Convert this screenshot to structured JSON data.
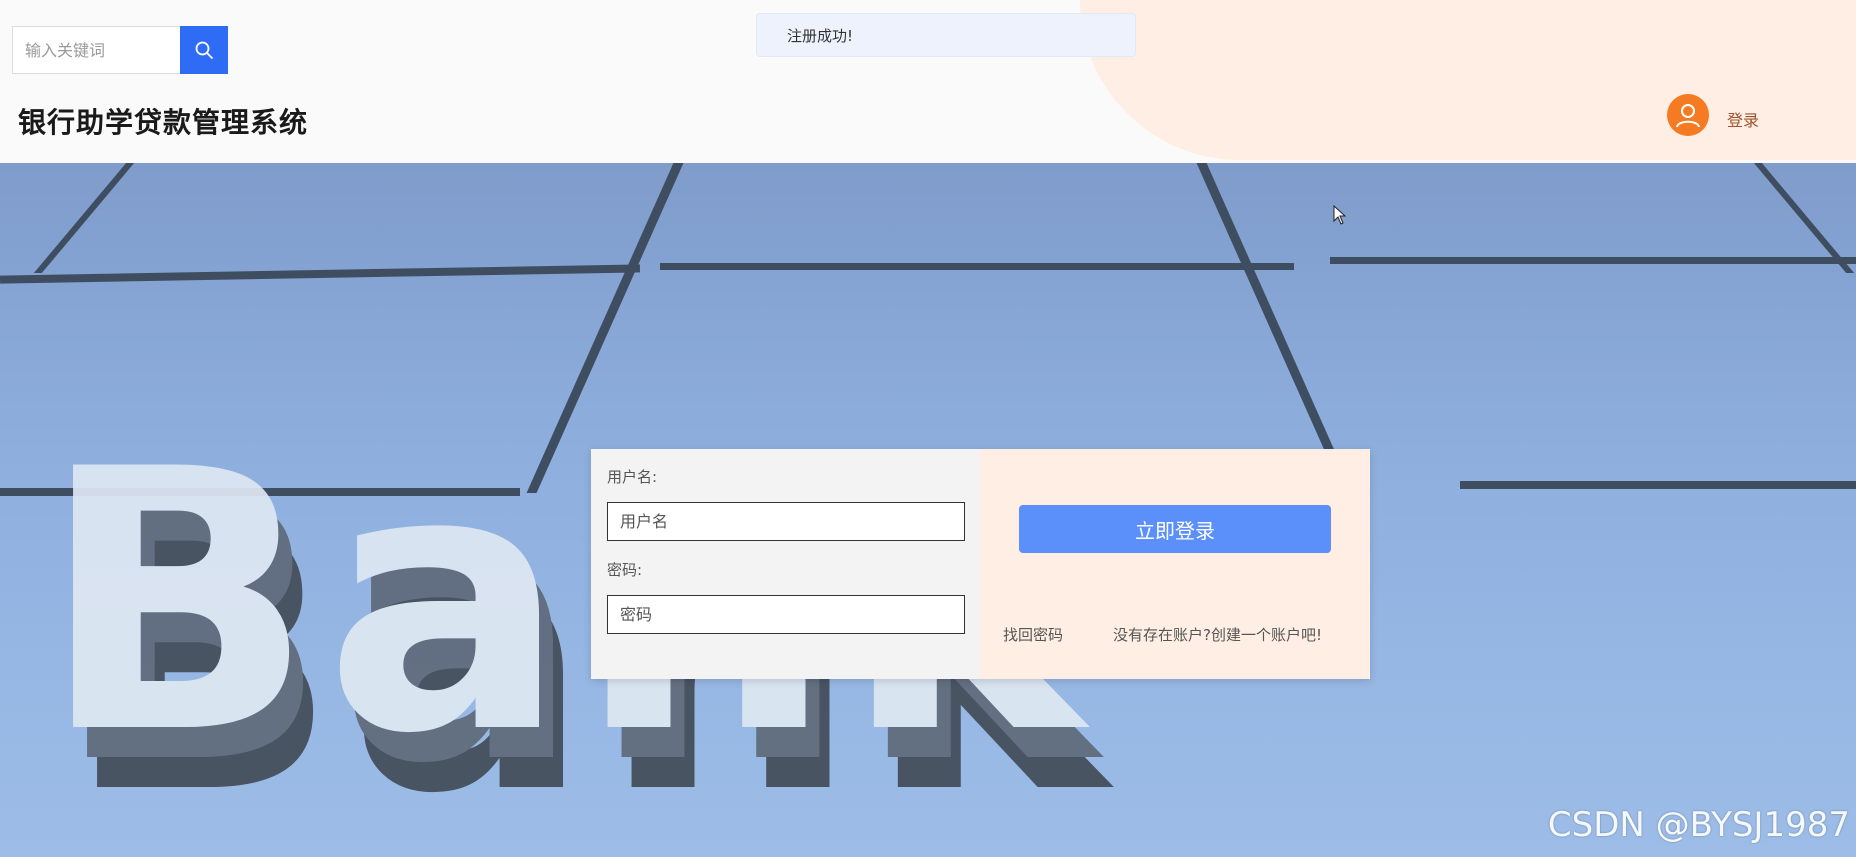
{
  "header": {
    "search": {
      "placeholder": "输入关键词"
    },
    "title": "银行助学贷款管理系统",
    "toast": "注册成功!",
    "login_link": "登录",
    "icons": {
      "search": "search-icon",
      "avatar": "user-icon"
    },
    "colors": {
      "accent": "#2f6cf6",
      "avatar": "#f47b22",
      "blob": "#ffeee4"
    }
  },
  "hero": {
    "background_text": "Bank",
    "watermark": "CSDN @BYSJ1987"
  },
  "login_form": {
    "username_label": "用户名:",
    "username_placeholder": "用户名",
    "password_label": "密码:",
    "password_placeholder": "密码",
    "submit_label": "立即登录",
    "forgot_label": "找回密码",
    "register_label": "没有存在账户?创建一个账户吧!",
    "colors": {
      "button": "#5b8ff9"
    }
  }
}
